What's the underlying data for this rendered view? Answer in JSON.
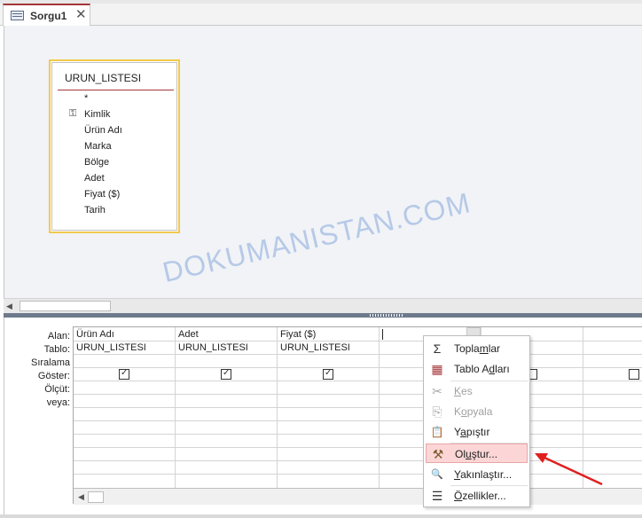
{
  "tab": {
    "label": "Sorgu1",
    "close": "✕"
  },
  "table": {
    "name": "URUN_LISTESI",
    "fields": [
      "*",
      "Kimlik",
      "Ürün Adı",
      "Marka",
      "Bölge",
      "Adet",
      "Fiyat ($)",
      "Tarih"
    ],
    "primary_key": "Kimlik"
  },
  "grid": {
    "row_labels": [
      "Alan:",
      "Tablo:",
      "Sıralama:",
      "Göster:",
      "Ölçüt:",
      "veya:"
    ],
    "columns": [
      {
        "field": "Ürün Adı",
        "table": "URUN_LISTESI",
        "show": true
      },
      {
        "field": "Adet",
        "table": "URUN_LISTESI",
        "show": true
      },
      {
        "field": "Fiyat ($)",
        "table": "URUN_LISTESI",
        "show": true
      },
      {
        "field": "",
        "table": "",
        "show": false
      },
      {
        "field": "",
        "table": "",
        "show": false
      },
      {
        "field": "",
        "table": "",
        "show": false
      }
    ]
  },
  "context_menu": {
    "items": [
      {
        "label_pre": "Topla",
        "label_u": "m",
        "label_post": "lar",
        "icon": "sigma-icon",
        "glyph": "Σ",
        "disabled": false,
        "highlighted": false
      },
      {
        "label_pre": "Tablo A",
        "label_u": "d",
        "label_post": "ları",
        "icon": "table-names-icon",
        "glyph": "▦",
        "disabled": false,
        "highlighted": false
      },
      {
        "label_pre": "",
        "label_u": "K",
        "label_post": "es",
        "icon": "scissors-icon",
        "glyph": "✂",
        "disabled": true,
        "highlighted": false
      },
      {
        "label_pre": "K",
        "label_u": "o",
        "label_post": "pyala",
        "icon": "copy-icon",
        "glyph": "⎘",
        "disabled": true,
        "highlighted": false
      },
      {
        "label_pre": "Y",
        "label_u": "a",
        "label_post": "pıştır",
        "icon": "paste-icon",
        "glyph": "📋",
        "disabled": false,
        "highlighted": false
      },
      {
        "label_pre": "Ol",
        "label_u": "u",
        "label_post": "ştur...",
        "icon": "builder-wand-icon",
        "glyph": "⚒",
        "disabled": false,
        "highlighted": true
      },
      {
        "label_pre": "",
        "label_u": "Y",
        "label_post": "akınlaştır...",
        "icon": "zoom-icon",
        "glyph": "🔍",
        "disabled": false,
        "highlighted": false
      },
      {
        "label_pre": "",
        "label_u": "Ö",
        "label_post": "zellikler...",
        "icon": "properties-icon",
        "glyph": "☰",
        "disabled": false,
        "highlighted": false
      }
    ]
  },
  "watermark": "DOKUMANISTAN.COM",
  "colors": {
    "accent": "#a4373a",
    "table_border": "#f2c94c",
    "highlight": "#fcd6d6",
    "arrow": "#e02020"
  }
}
